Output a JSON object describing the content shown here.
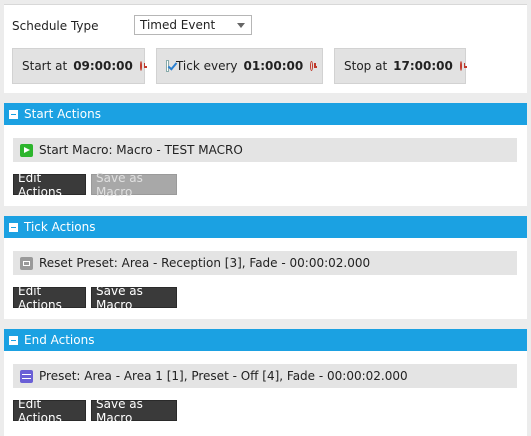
{
  "schedule": {
    "type_label": "Schedule Type",
    "type_value": "Timed Event",
    "start": {
      "label": "Start at",
      "time": "09:00:00"
    },
    "tick": {
      "label": "Tick every",
      "time": "01:00:00",
      "checked": true
    },
    "stop": {
      "label": "Stop at",
      "time": "17:00:00"
    }
  },
  "sections": {
    "start": {
      "title": "Start Actions",
      "action": "Start Macro: Macro - TEST MACRO",
      "action_icon": "play-macro-icon",
      "edit_label": "Edit Actions",
      "save_label": "Save as Macro",
      "save_enabled": false
    },
    "tick": {
      "title": "Tick Actions",
      "action": "Reset Preset: Area - Reception [3], Fade - 00:00:02.000",
      "action_icon": "reset-preset-icon",
      "edit_label": "Edit Actions",
      "save_label": "Save as Macro",
      "save_enabled": true
    },
    "end": {
      "title": "End Actions",
      "action": "Preset: Area - Area 1 [1], Preset - Off [4], Fade - 00:00:02.000",
      "action_icon": "preset-icon",
      "edit_label": "Edit Actions",
      "save_label": "Save as Macro",
      "save_enabled": true
    }
  },
  "colors": {
    "header_blue": "#1ba1e2",
    "clock_red": "#c0392b",
    "button_dark": "#3a3a3a"
  }
}
